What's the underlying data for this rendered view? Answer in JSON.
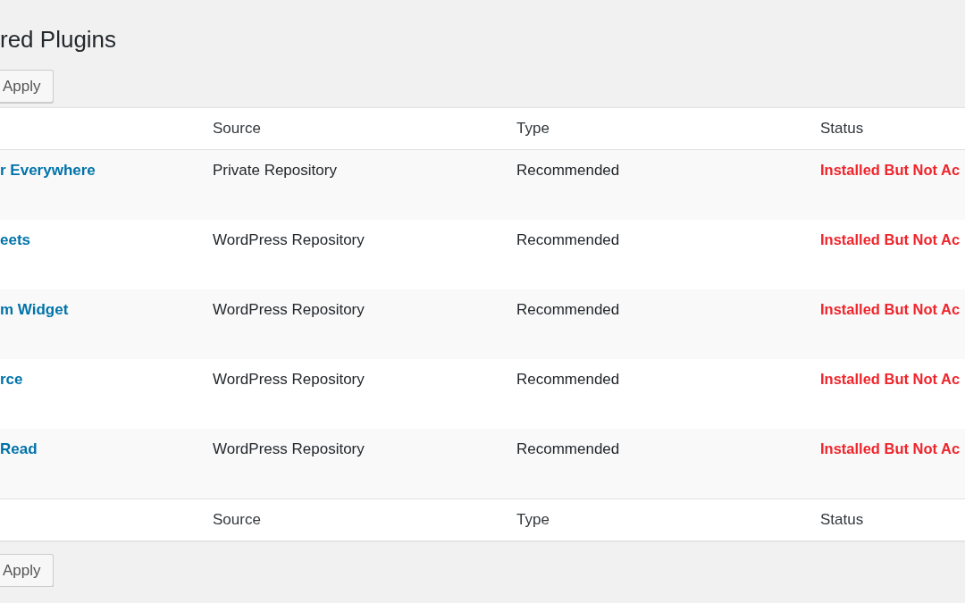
{
  "page_title": "red Plugins",
  "top_actions": {
    "button": "Apply"
  },
  "table": {
    "columns": [
      "Source",
      "Type",
      "Status"
    ],
    "rows": [
      {
        "plugin": "r Everywhere",
        "source": "Private Repository",
        "type": "Recommended",
        "status": "Installed But Not Ac"
      },
      {
        "plugin": "eets",
        "source": "WordPress Repository",
        "type": "Recommended",
        "status": "Installed But Not Ac"
      },
      {
        "plugin": "m Widget",
        "source": "WordPress Repository",
        "type": "Recommended",
        "status": "Installed But Not Ac"
      },
      {
        "plugin": "rce",
        "source": "WordPress Repository",
        "type": "Recommended",
        "status": "Installed But Not Ac"
      },
      {
        "plugin": "Read",
        "source": "WordPress Repository",
        "type": "Recommended",
        "status": "Installed But Not Ac"
      }
    ],
    "footer_columns": [
      "Source",
      "Type",
      "Status"
    ]
  },
  "bottom_actions": {
    "button": "Apply"
  }
}
